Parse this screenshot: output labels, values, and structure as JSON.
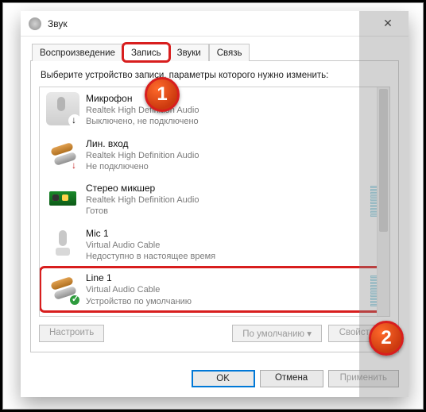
{
  "window": {
    "title": "Звук"
  },
  "tabs": [
    {
      "label": "Воспроизведение"
    },
    {
      "label": "Запись"
    },
    {
      "label": "Звуки"
    },
    {
      "label": "Связь"
    }
  ],
  "instruction": "Выберите устройство записи, параметры которого нужно изменить:",
  "devices": [
    {
      "name": "Микрофон",
      "driver": "Realtek High Definition Audio",
      "status": "Выключено, не подключено",
      "icon": "mic",
      "badge": "down",
      "meter": false
    },
    {
      "name": "Лин. вход",
      "driver": "Realtek High Definition Audio",
      "status": "Не подключено",
      "icon": "jack",
      "badge": "red",
      "meter": false
    },
    {
      "name": "Стерео микшер",
      "driver": "Realtek High Definition Audio",
      "status": "Готов",
      "icon": "card",
      "badge": "none",
      "meter": true
    },
    {
      "name": "Mic 1",
      "driver": "Virtual Audio Cable",
      "status": "Недоступно в настоящее время",
      "icon": "mic2",
      "badge": "none",
      "meter": false
    },
    {
      "name": "Line 1",
      "driver": "Virtual Audio Cable",
      "status": "Устройство по умолчанию",
      "icon": "jack",
      "badge": "green",
      "meter": true
    }
  ],
  "buttons": {
    "configure": "Настроить",
    "default": "По умолчанию",
    "properties": "Свойства"
  },
  "footer": {
    "ok": "OK",
    "cancel": "Отмена",
    "apply": "Применить"
  },
  "callouts": {
    "c1": "1",
    "c2": "2"
  }
}
